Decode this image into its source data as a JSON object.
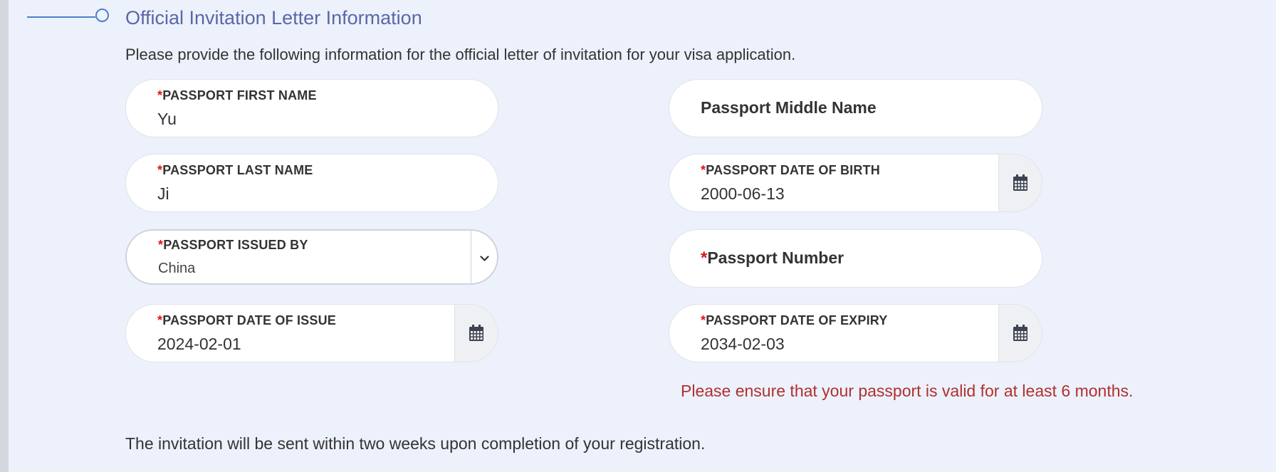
{
  "section": {
    "title": "Official Invitation Letter Information",
    "intro": "Please provide the following information for the official letter of invitation for your visa application."
  },
  "fields": {
    "first_name": {
      "label": "PASSPORT FIRST NAME",
      "value": "Yu",
      "required": true
    },
    "middle_name": {
      "placeholder": "Passport Middle Name",
      "value": ""
    },
    "last_name": {
      "label": "PASSPORT LAST NAME",
      "value": "Ji",
      "required": true
    },
    "date_of_birth": {
      "label": "PASSPORT DATE OF BIRTH",
      "value": "2000-06-13",
      "required": true
    },
    "issued_by": {
      "label": "PASSPORT ISSUED BY",
      "value": "China",
      "required": true
    },
    "passport_number": {
      "placeholder": "Passport Number",
      "value": "",
      "required": true
    },
    "date_of_issue": {
      "label": "PASSPORT DATE OF ISSUE",
      "value": "2024-02-01",
      "required": true
    },
    "date_of_expiry": {
      "label": "PASSPORT DATE OF EXPIRY",
      "value": "2034-02-03",
      "required": true
    }
  },
  "required_marker": "*",
  "warning": "Please ensure that your passport is valid for at least 6 months.",
  "footer_note": "The invitation will be sent within two weeks upon completion of your registration.",
  "icons": {
    "calendar": "calendar-icon",
    "dropdown": "chevron-down-icon",
    "step": "step-circle-icon"
  },
  "colors": {
    "page_background": "#edf1fb",
    "section_title": "#5868a8",
    "step_accent": "#4a82c4",
    "required": "#e0141e",
    "warning": "#b03030"
  }
}
